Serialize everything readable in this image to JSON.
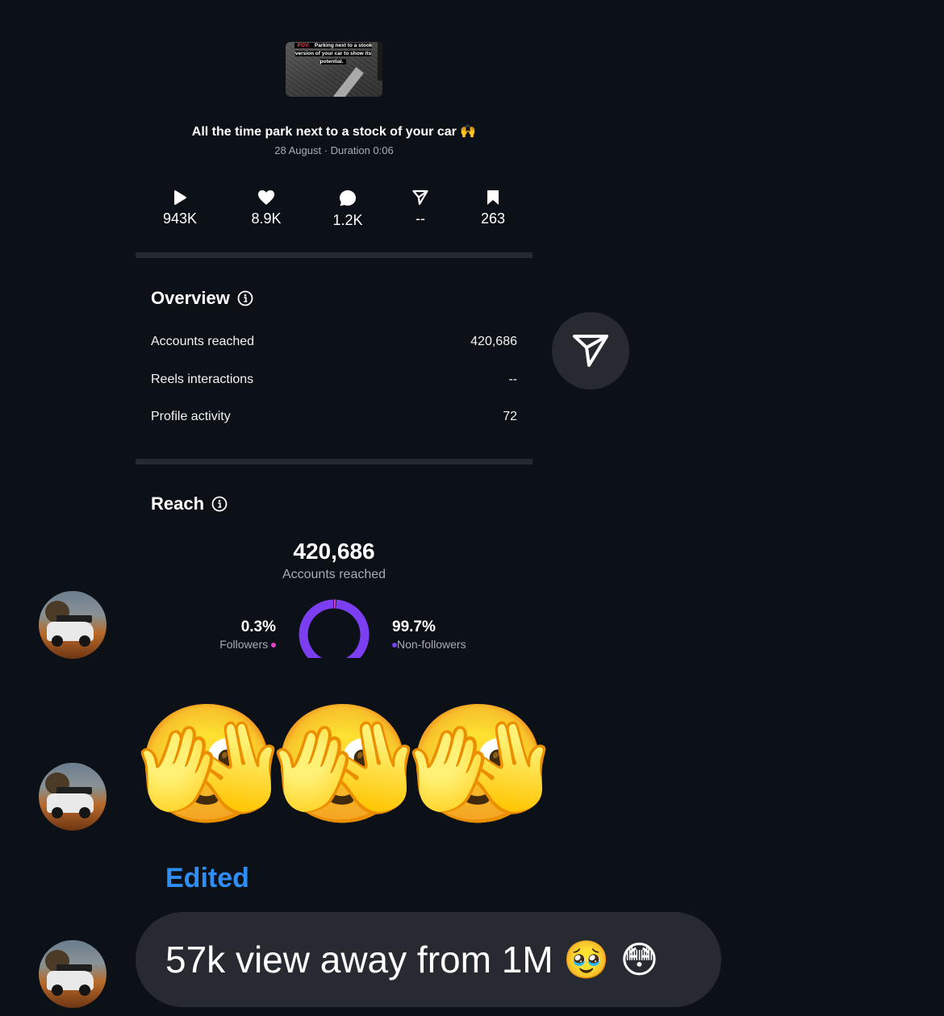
{
  "reel": {
    "thumbnail_caption_pov": "POV:",
    "thumbnail_caption_text": "Parking next to a stook version of your car to show its potential.",
    "title": "All the time park next to a stock of your car 🙌",
    "meta": "28 August · Duration 0:06"
  },
  "stats": [
    {
      "icon": "play-icon",
      "value": "943K"
    },
    {
      "icon": "heart-icon",
      "value": "8.9K"
    },
    {
      "icon": "comment-icon",
      "value": "1.2K"
    },
    {
      "icon": "share-icon",
      "value": "--"
    },
    {
      "icon": "bookmark-icon",
      "value": "263"
    }
  ],
  "overview": {
    "title": "Overview",
    "rows": [
      {
        "label": "Accounts reached",
        "value": "420,686"
      },
      {
        "label": "Reels interactions",
        "value": "--"
      },
      {
        "label": "Profile activity",
        "value": "72"
      }
    ]
  },
  "reach": {
    "title": "Reach",
    "total": "420,686",
    "total_label": "Accounts reached",
    "followers_pct": "0.3%",
    "followers_label": "Followers",
    "non_followers_pct": "99.7%",
    "non_followers_label": "Non-followers",
    "followers_fraction": 0.003,
    "non_followers_fraction": 0.997,
    "followers_color": "#e040c8",
    "non_followers_color": "#7b3ef0"
  },
  "messages": {
    "emojis": [
      "🫣",
      "🫣",
      "🫣"
    ],
    "edited_label": "Edited",
    "last_message": "57k view away from 1M 🥹 😳"
  },
  "colors": {
    "background": "#0c1017",
    "bubble": "#272b31",
    "edited": "#2f8ef5"
  }
}
